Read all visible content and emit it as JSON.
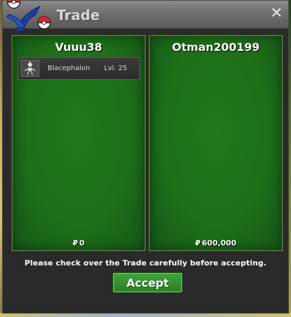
{
  "window": {
    "title": "Trade",
    "close_icon": "close-icon",
    "logo_icon": "pokeball-logo-icon"
  },
  "left_panel": {
    "trainer": "Vuuu38",
    "currency_symbol": "₽",
    "money": "0",
    "items": [
      {
        "icon": "pokemon-sprite-icon",
        "name": "Blacephalon",
        "level": "Lvl. 25"
      }
    ]
  },
  "right_panel": {
    "trainer": "Otman200199",
    "currency_symbol": "₽",
    "money": "600,000",
    "items": []
  },
  "footer": {
    "notice": "Please check over the Trade carefully before accepting.",
    "accept_label": "Accept"
  },
  "colors": {
    "panel_green": "#1f7a1a",
    "accept_green": "#3fa33a",
    "titlebar_gray": "#7a7a7a"
  }
}
